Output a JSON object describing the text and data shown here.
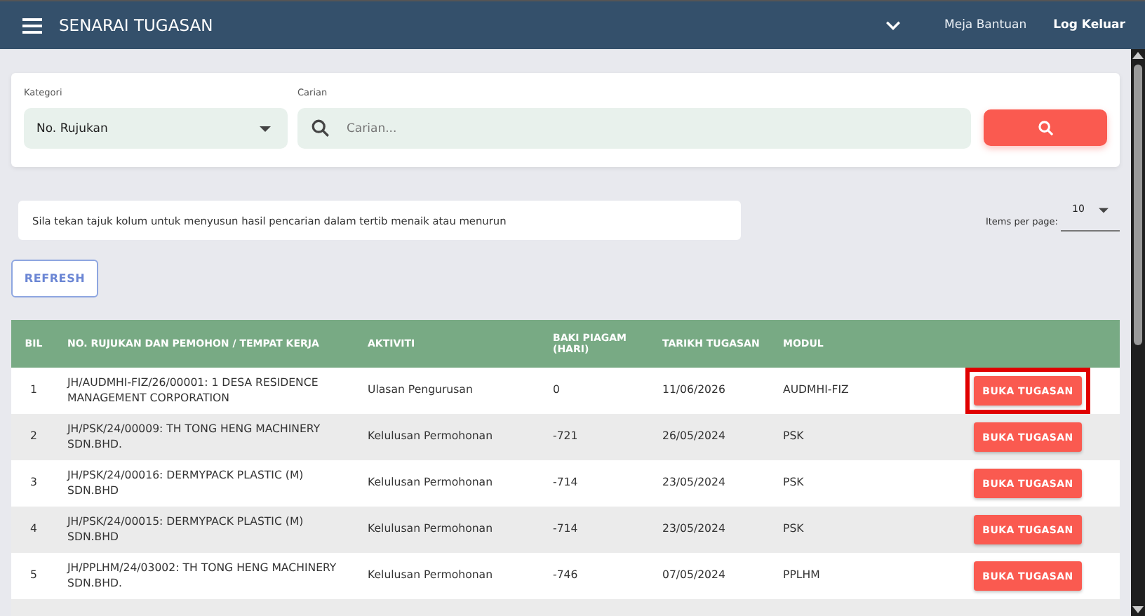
{
  "header": {
    "title": "SENARAI TUGASAN",
    "links": [
      "Meja Bantuan",
      "Log Keluar"
    ]
  },
  "filter": {
    "category_label": "Kategori",
    "category_value": "No. Rujukan",
    "search_label": "Carian",
    "search_placeholder": "Carian..."
  },
  "hint": "Sila tekan tajuk kolum untuk menyusun hasil pencarian dalam tertib menaik atau menurun",
  "pagination": {
    "label": "Items per page:",
    "value": "10"
  },
  "refresh_button": "REFRESH",
  "table": {
    "columns": [
      "BIL",
      "NO. RUJUKAN DAN PEMOHON / TEMPAT KERJA",
      "AKTIVITI",
      "BAKI PIAGAM (HARI)",
      "TARIKH TUGASAN",
      "MODUL"
    ],
    "rows": [
      {
        "bil": "1",
        "ref": "JH/AUDMHI-FIZ/26/00001: 1 DESA RESIDENCE MANAGEMENT CORPORATION",
        "activity": "Ulasan Pengurusan",
        "days": "0",
        "date": "11/06/2026",
        "module": "AUDMHI-FIZ",
        "action": "BUKA TUGASAN",
        "highlighted": true
      },
      {
        "bil": "2",
        "ref": "JH/PSK/24/00009: TH TONG HENG MACHINERY SDN.BHD.",
        "activity": "Kelulusan Permohonan",
        "days": "-721",
        "date": "26/05/2024",
        "module": "PSK",
        "action": "BUKA TUGASAN",
        "highlighted": false
      },
      {
        "bil": "3",
        "ref": "JH/PSK/24/00016: DERMYPACK PLASTIC (M) SDN.BHD",
        "activity": "Kelulusan Permohonan",
        "days": "-714",
        "date": "23/05/2024",
        "module": "PSK",
        "action": "BUKA TUGASAN",
        "highlighted": false
      },
      {
        "bil": "4",
        "ref": "JH/PSK/24/00015: DERMYPACK PLASTIC (M) SDN.BHD",
        "activity": "Kelulusan Permohonan",
        "days": "-714",
        "date": "23/05/2024",
        "module": "PSK",
        "action": "BUKA TUGASAN",
        "highlighted": false
      },
      {
        "bil": "5",
        "ref": "JH/PPLHM/24/03002: TH TONG HENG MACHINERY SDN.BHD.",
        "activity": "Kelulusan Permohonan",
        "days": "-746",
        "date": "07/05/2024",
        "module": "PPLHM",
        "action": "BUKA TUGASAN",
        "highlighted": false
      }
    ]
  }
}
